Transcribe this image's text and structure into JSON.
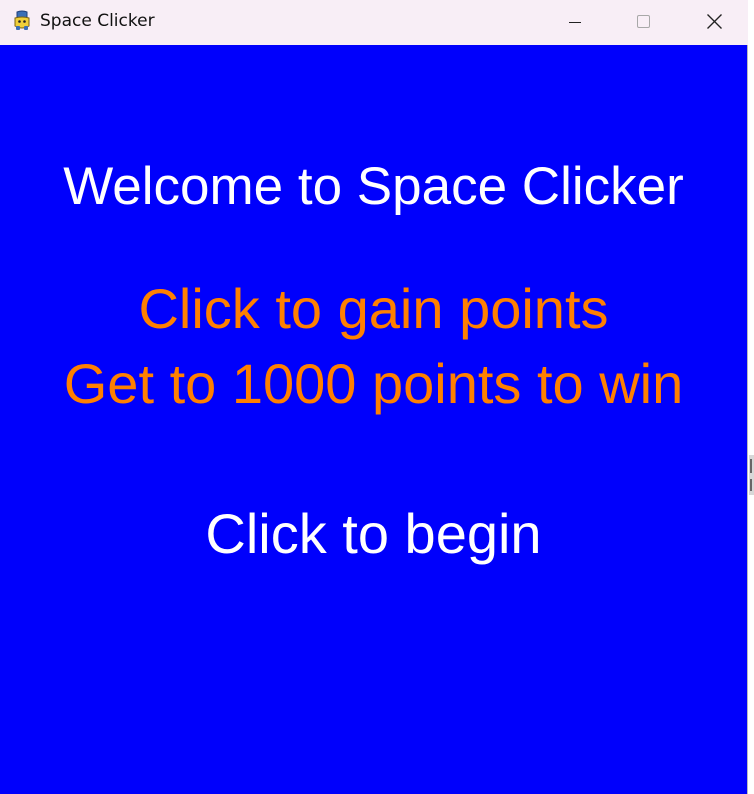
{
  "window": {
    "title": "Space Clicker",
    "icon": "python-icon",
    "controls": [
      "minimize-icon",
      "maximize-icon",
      "close-icon"
    ]
  },
  "screen": {
    "welcome": "Welcome to Space Clicker",
    "instruction_1": "Click to gain points",
    "instruction_2": "Get to 1000 points to win",
    "begin": "Click to begin"
  },
  "colors": {
    "background": "#0000fc",
    "heading_text": "#ffffff",
    "instruction_text": "#ff8000",
    "titlebar": "#f8eef6"
  }
}
